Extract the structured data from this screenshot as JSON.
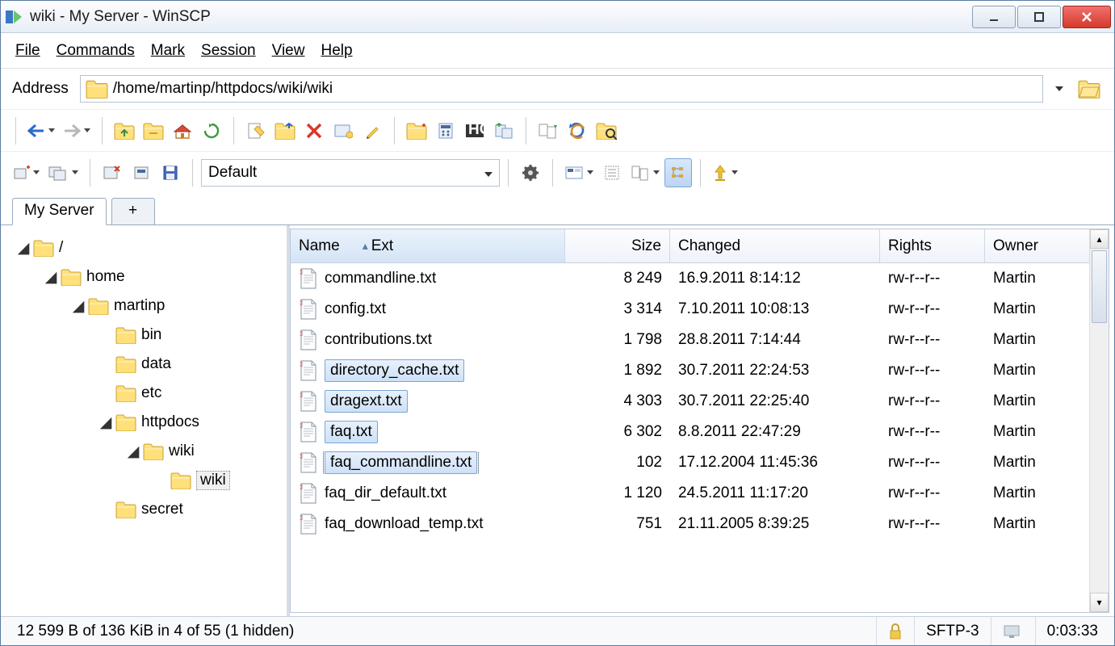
{
  "window": {
    "title": "wiki - My Server - WinSCP"
  },
  "menu": {
    "file": "File",
    "commands": "Commands",
    "mark": "Mark",
    "session": "Session",
    "view": "View",
    "help": "Help"
  },
  "address": {
    "label": "Address",
    "path": "/home/martinp/httpdocs/wiki/wiki"
  },
  "transfer": {
    "preset": "Default"
  },
  "tabs": {
    "active": "My Server",
    "add": "+"
  },
  "tree": [
    {
      "depth": 0,
      "label": "/ <root>",
      "expanded": true
    },
    {
      "depth": 1,
      "label": "home",
      "expanded": true
    },
    {
      "depth": 2,
      "label": "martinp",
      "expanded": true
    },
    {
      "depth": 3,
      "label": "bin",
      "expanded": false,
      "leaf": true
    },
    {
      "depth": 3,
      "label": "data",
      "expanded": false,
      "leaf": true
    },
    {
      "depth": 3,
      "label": "etc",
      "expanded": false,
      "leaf": true
    },
    {
      "depth": 3,
      "label": "httpdocs",
      "expanded": true
    },
    {
      "depth": 4,
      "label": "wiki",
      "expanded": true
    },
    {
      "depth": 5,
      "label": "wiki",
      "expanded": false,
      "leaf": true,
      "selected": true
    },
    {
      "depth": 3,
      "label": "secret",
      "expanded": false,
      "leaf": true
    }
  ],
  "columns": {
    "name": "Name",
    "ext": "Ext",
    "size": "Size",
    "changed": "Changed",
    "rights": "Rights",
    "owner": "Owner"
  },
  "files": [
    {
      "name": "commandline.txt",
      "size": "8 249",
      "changed": "16.9.2011 8:14:12",
      "rights": "rw-r--r--",
      "owner": "Martin"
    },
    {
      "name": "config.txt",
      "size": "3 314",
      "changed": "7.10.2011 10:08:13",
      "rights": "rw-r--r--",
      "owner": "Martin"
    },
    {
      "name": "contributions.txt",
      "size": "1 798",
      "changed": "28.8.2011 7:14:44",
      "rights": "rw-r--r--",
      "owner": "Martin"
    },
    {
      "name": "directory_cache.txt",
      "size": "1 892",
      "changed": "30.7.2011 22:24:53",
      "rights": "rw-r--r--",
      "owner": "Martin",
      "selected": true
    },
    {
      "name": "dragext.txt",
      "size": "4 303",
      "changed": "30.7.2011 22:25:40",
      "rights": "rw-r--r--",
      "owner": "Martin",
      "selected": true
    },
    {
      "name": "faq.txt",
      "size": "6 302",
      "changed": "8.8.2011 22:47:29",
      "rights": "rw-r--r--",
      "owner": "Martin",
      "selected": true
    },
    {
      "name": "faq_commandline.txt",
      "size": "102",
      "changed": "17.12.2004 11:45:36",
      "rights": "rw-r--r--",
      "owner": "Martin",
      "selected": true,
      "focused": true
    },
    {
      "name": "faq_dir_default.txt",
      "size": "1 120",
      "changed": "24.5.2011 11:17:20",
      "rights": "rw-r--r--",
      "owner": "Martin"
    },
    {
      "name": "faq_download_temp.txt",
      "size": "751",
      "changed": "21.11.2005 8:39:25",
      "rights": "rw-r--r--",
      "owner": "Martin"
    }
  ],
  "status": {
    "selection": "12 599 B of 136 KiB in 4 of 55 (1 hidden)",
    "protocol": "SFTP-3",
    "time": "0:03:33"
  }
}
